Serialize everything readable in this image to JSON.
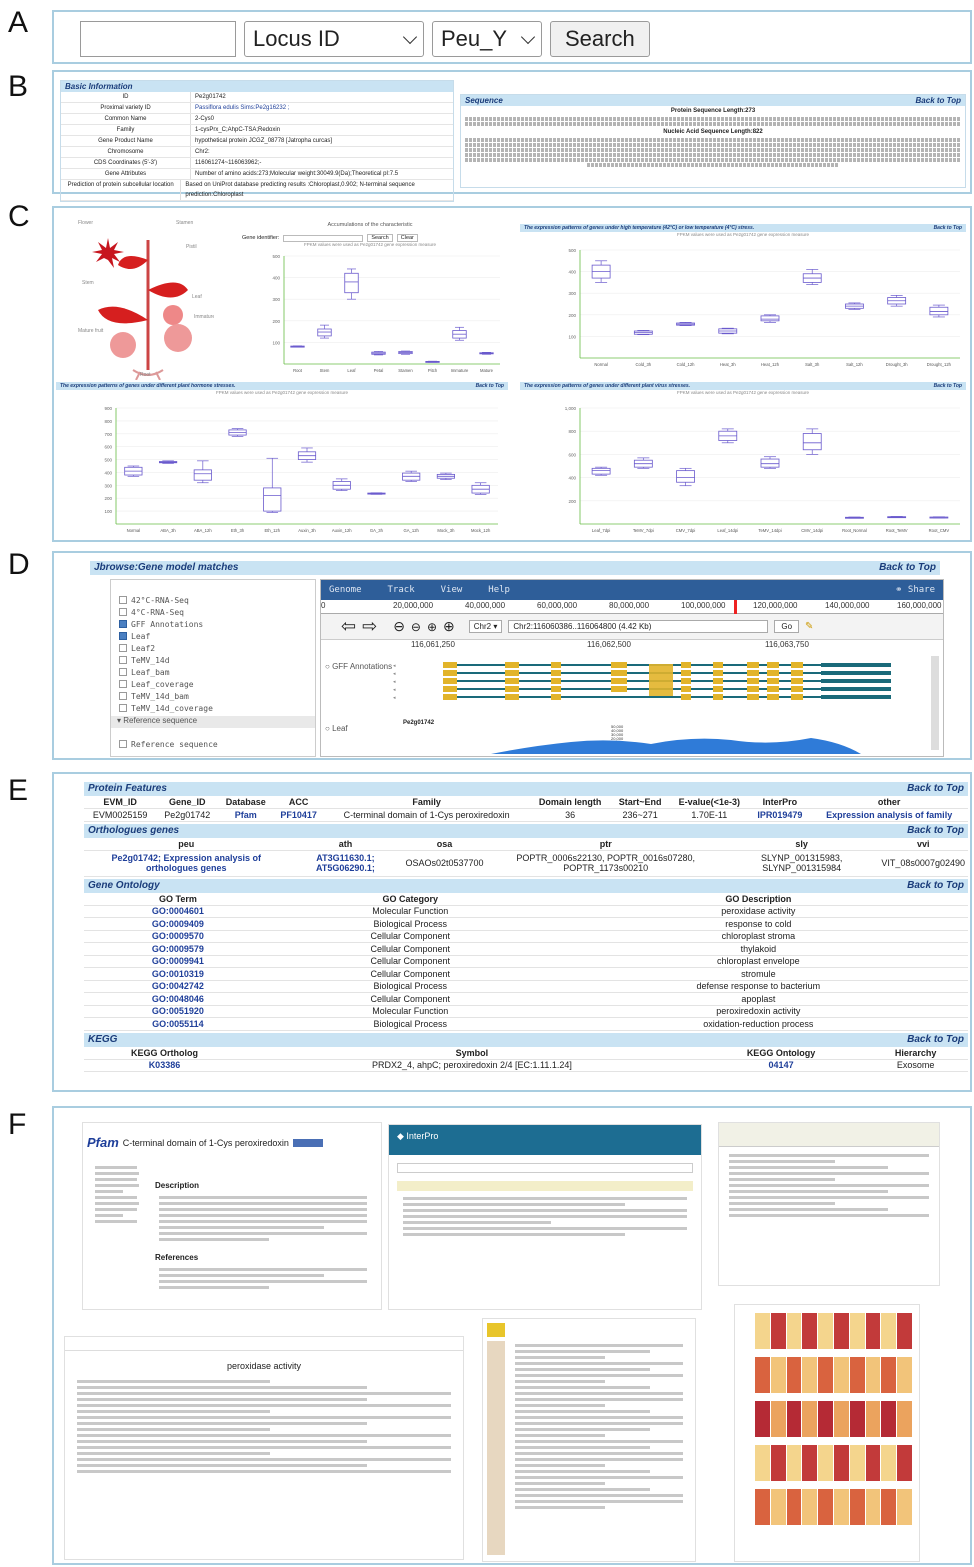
{
  "panel_labels": [
    "A",
    "B",
    "C",
    "D",
    "E",
    "F"
  ],
  "search": {
    "input_value": "",
    "field_select": "Locus ID",
    "species_select": "Peu_Y",
    "button": "Search"
  },
  "basic_info": {
    "header": "Basic Information",
    "rows": [
      {
        "k": "ID",
        "v": "Pe2g01742"
      },
      {
        "k": "Proximal variety ID",
        "v": "Passiflora edulis Sims:Pe2g16232 ;"
      },
      {
        "k": "Common Name",
        "v": "2-Cys0"
      },
      {
        "k": "Family",
        "v": "1-cysPrx_C;AhpC-TSA;Redoxin"
      },
      {
        "k": "Gene Product Name",
        "v": "hypothetical protein JCGZ_08778 [Jatropha curcas]"
      },
      {
        "k": "Chromosome",
        "v": "Chr2:"
      },
      {
        "k": "CDS Coordinates (5'-3')",
        "v": "116061274~116063962;-"
      },
      {
        "k": "Gene Attributes",
        "v": "Number of amino acids:273;Molecular weight:30049.9(Da);Theoretical pI:7.5"
      },
      {
        "k": "Prediction of protein subcellular location",
        "v": "Based on UniProt database predicting results :Chloroplast,0.902; N-terminal sequence prediction:Chloroplast"
      }
    ]
  },
  "sequence": {
    "header": "Sequence",
    "back": "Back to Top",
    "protein_label": "Protein Sequence   Length:273",
    "nucleic_label": "Nucleic Acid Sequence   Length:822"
  },
  "c_panel": {
    "tissue_title": "Accumulations of the characteristic",
    "gene_identifier_label": "Gene identifier:",
    "search_btn": "Search",
    "clear_btn": "Clear",
    "measure_caption": "FPKM values were used as Pe2g01742 gene expression measure",
    "tissue_labels": [
      "Flower",
      "Stamen",
      "Pistil",
      "Stem",
      "Leaf",
      "Root",
      "Immature fruit",
      "Mature fruit"
    ],
    "temp_header": "The expression patterns of genes under high temperature (42°C) or low temperature (4°C) stress.",
    "hormone_header": "The expression patterns of genes under different plant hormone stresses.",
    "virus_header": "The expression patterns of genes under different plant virus stresses.",
    "back": "Back to Top"
  },
  "chart_data": [
    {
      "type": "box",
      "categories": [
        "Root",
        "Stem",
        "Leaf",
        "Petal",
        "Stamen",
        "Pitch",
        "Immature",
        "Mature"
      ],
      "yticks": [
        100,
        200,
        300,
        400,
        500
      ],
      "ylim": [
        0,
        500
      ],
      "boxes": [
        {
          "min": 80,
          "q1": 78,
          "med": 80,
          "q3": 83,
          "max": 84
        },
        {
          "min": 120,
          "q1": 130,
          "med": 148,
          "q3": 162,
          "max": 180
        },
        {
          "min": 300,
          "q1": 330,
          "med": 380,
          "q3": 420,
          "max": 440
        },
        {
          "min": 42,
          "q1": 45,
          "med": 50,
          "q3": 55,
          "max": 58
        },
        {
          "min": 45,
          "q1": 48,
          "med": 53,
          "q3": 58,
          "max": 60
        },
        {
          "min": 8,
          "q1": 9,
          "med": 10,
          "q3": 12,
          "max": 13
        },
        {
          "min": 110,
          "q1": 120,
          "med": 138,
          "q3": 155,
          "max": 170
        },
        {
          "min": 45,
          "q1": 47,
          "med": 50,
          "q3": 52,
          "max": 54
        }
      ]
    },
    {
      "type": "box",
      "categories": [
        "Normal",
        "Cold_3h",
        "Cold_12h",
        "Heat_3h",
        "Heat_12h",
        "Salt_3h",
        "Salt_12h",
        "Drought_3h",
        "Drought_12h"
      ],
      "yticks": [
        100,
        200,
        300,
        400,
        500
      ],
      "ylim": [
        0,
        500
      ],
      "boxes": [
        {
          "min": 350,
          "q1": 370,
          "med": 400,
          "q3": 430,
          "max": 450
        },
        {
          "min": 108,
          "q1": 110,
          "med": 118,
          "q3": 125,
          "max": 128
        },
        {
          "min": 150,
          "q1": 152,
          "med": 157,
          "q3": 162,
          "max": 165
        },
        {
          "min": 112,
          "q1": 115,
          "med": 125,
          "q3": 135,
          "max": 138
        },
        {
          "min": 165,
          "q1": 172,
          "med": 180,
          "q3": 195,
          "max": 200
        },
        {
          "min": 340,
          "q1": 350,
          "med": 370,
          "q3": 390,
          "max": 410
        },
        {
          "min": 225,
          "q1": 230,
          "med": 240,
          "q3": 250,
          "max": 255
        },
        {
          "min": 240,
          "q1": 250,
          "med": 265,
          "q3": 280,
          "max": 290
        },
        {
          "min": 190,
          "q1": 200,
          "med": 215,
          "q3": 235,
          "max": 245
        }
      ]
    },
    {
      "type": "box",
      "categories": [
        "Normal",
        "ABA_3h",
        "ABA_12h",
        "Eth_3h",
        "Eth_12h",
        "Auxin_3h",
        "Auxin_12h",
        "GA_3h",
        "GA_12h",
        "Mock_3h",
        "Mock_12h"
      ],
      "yticks": [
        100,
        200,
        300,
        400,
        500,
        600,
        700,
        800,
        900
      ],
      "ylim": [
        0,
        900
      ],
      "boxes": [
        {
          "min": 370,
          "q1": 380,
          "med": 410,
          "q3": 440,
          "max": 450
        },
        {
          "min": 470,
          "q1": 475,
          "med": 480,
          "q3": 485,
          "max": 490
        },
        {
          "min": 320,
          "q1": 340,
          "med": 390,
          "q3": 420,
          "max": 490
        },
        {
          "min": 680,
          "q1": 690,
          "med": 710,
          "q3": 730,
          "max": 740
        },
        {
          "min": 90,
          "q1": 100,
          "med": 220,
          "q3": 280,
          "max": 510
        },
        {
          "min": 480,
          "q1": 500,
          "med": 530,
          "q3": 560,
          "max": 590
        },
        {
          "min": 260,
          "q1": 270,
          "med": 300,
          "q3": 330,
          "max": 350
        },
        {
          "min": 230,
          "q1": 232,
          "med": 236,
          "q3": 240,
          "max": 242
        },
        {
          "min": 330,
          "q1": 340,
          "med": 370,
          "q3": 395,
          "max": 410
        },
        {
          "min": 345,
          "q1": 355,
          "med": 370,
          "q3": 385,
          "max": 395
        },
        {
          "min": 230,
          "q1": 240,
          "med": 270,
          "q3": 300,
          "max": 320
        }
      ]
    },
    {
      "type": "box",
      "categories": [
        "Leaf_7dpi",
        "TeMV_7dpi",
        "CMV_7dpi",
        "Leaf_14dpi",
        "TeMV_14dpi",
        "CMV_14dpi",
        "Root_Normal",
        "Root_TeMV",
        "Root_CMV"
      ],
      "yticks": [
        200,
        400,
        600,
        800,
        1000
      ],
      "ylim": [
        0,
        1000
      ],
      "boxes": [
        {
          "min": 420,
          "q1": 430,
          "med": 460,
          "q3": 480,
          "max": 490
        },
        {
          "min": 480,
          "q1": 490,
          "med": 520,
          "q3": 550,
          "max": 570
        },
        {
          "min": 330,
          "q1": 360,
          "med": 400,
          "q3": 460,
          "max": 480
        },
        {
          "min": 700,
          "q1": 720,
          "med": 760,
          "q3": 800,
          "max": 820
        },
        {
          "min": 480,
          "q1": 490,
          "med": 520,
          "q3": 560,
          "max": 580
        },
        {
          "min": 600,
          "q1": 640,
          "med": 700,
          "q3": 780,
          "max": 820
        },
        {
          "min": 50,
          "q1": 52,
          "med": 55,
          "q3": 58,
          "max": 60
        },
        {
          "min": 55,
          "q1": 57,
          "med": 60,
          "q3": 63,
          "max": 65
        },
        {
          "min": 52,
          "q1": 54,
          "med": 57,
          "q3": 60,
          "max": 62
        }
      ]
    }
  ],
  "jbrowse": {
    "header": "Jbrowse:Gene model matches",
    "back": "Back to Top",
    "menu": [
      "Genome",
      "Track",
      "View",
      "Help"
    ],
    "share": "Share",
    "ruler": [
      "0",
      "20,000,000",
      "40,000,000",
      "60,000,000",
      "80,000,000",
      "100,000,000",
      "120,000,000",
      "140,000,000",
      "160,000,000"
    ],
    "chrom": "Chr2",
    "locus": "Chr2:116060386..116064800 (4.42 Kb)",
    "go": "Go",
    "subruler": [
      "116,061,250",
      "116,062,500",
      "116,063,750"
    ],
    "tracks": [
      {
        "label": "42°C-RNA-Seq",
        "checked": false
      },
      {
        "label": "4°C-RNA-Seq",
        "checked": false
      },
      {
        "label": "GFF Annotations",
        "checked": true
      },
      {
        "label": "Leaf",
        "checked": true
      },
      {
        "label": "Leaf2",
        "checked": false
      },
      {
        "label": "TeMV_14d",
        "checked": false
      },
      {
        "label": "Leaf_bam",
        "checked": false
      },
      {
        "label": "Leaf_coverage",
        "checked": false
      },
      {
        "label": "TeMV_14d_bam",
        "checked": false
      },
      {
        "label": "TeMV_14d_coverage",
        "checked": false
      }
    ],
    "ref_section": "Reference sequence",
    "ref_track": "Reference sequence",
    "gff_label": "GFF Annotations",
    "leaf_label": "Leaf",
    "gene_label": "Pe2g01742",
    "coverage_ticks": [
      "50,000",
      "40,000",
      "30,000",
      "20,000"
    ]
  },
  "protein_features": {
    "header": "Protein Features",
    "back": "Back to Top",
    "columns": [
      "EVM_ID",
      "Gene_ID",
      "Database",
      "ACC",
      "Family",
      "Domain length",
      "Start~End",
      "E-value(<1e-3)",
      "InterPro",
      "other"
    ],
    "row": [
      "EVM0025159",
      "Pe2g01742",
      "Pfam",
      "PF10417",
      "C-terminal domain of 1-Cys peroxiredoxin",
      "36",
      "236~271",
      "1.70E-11",
      "IPR019479",
      "Expression analysis of family"
    ]
  },
  "orthologues": {
    "header": "Orthologues genes",
    "back": "Back to Top",
    "columns": [
      "peu",
      "ath",
      "osa",
      "ptr",
      "sly",
      "vvi"
    ],
    "row": [
      "Pe2g01742; Expression analysis of orthologues genes",
      "AT3G11630.1; AT5G06290.1;",
      "OSAOs02t0537700",
      "POPTR_0006s22130, POPTR_0016s07280, POPTR_1173s00210",
      "SLYNP_001315983, SLYNP_001315984",
      "VIT_08s0007g02490"
    ]
  },
  "gene_ontology": {
    "header": "Gene Ontology",
    "back": "Back to Top",
    "columns": [
      "GO Term",
      "GO Category",
      "GO Description"
    ],
    "rows": [
      [
        "GO:0004601",
        "Molecular Function",
        "peroxidase activity"
      ],
      [
        "GO:0009409",
        "Biological Process",
        "response to cold"
      ],
      [
        "GO:0009570",
        "Cellular Component",
        "chloroplast stroma"
      ],
      [
        "GO:0009579",
        "Cellular Component",
        "thylakoid"
      ],
      [
        "GO:0009941",
        "Cellular Component",
        "chloroplast envelope"
      ],
      [
        "GO:0010319",
        "Cellular Component",
        "stromule"
      ],
      [
        "GO:0042742",
        "Biological Process",
        "defense response to bacterium"
      ],
      [
        "GO:0048046",
        "Cellular Component",
        "apoplast"
      ],
      [
        "GO:0051920",
        "Molecular Function",
        "peroxiredoxin activity"
      ],
      [
        "GO:0055114",
        "Biological Process",
        "oxidation-reduction process"
      ]
    ]
  },
  "kegg": {
    "header": "KEGG",
    "back": "Back to Top",
    "columns": [
      "KEGG Ortholog",
      "Symbol",
      "KEGG Ontology",
      "Hierarchy"
    ],
    "row": [
      "K03386",
      "PRDX2_4, ahpC; peroxiredoxin 2/4 [EC:1.11.1.24]",
      "04147",
      "Exosome"
    ]
  },
  "f_panel": {
    "pfam_logo": "Pfam",
    "pfam_title": "C-terminal domain of 1-Cys peroxiredoxin",
    "pfam_desc": "Description",
    "pfam_refs": "References",
    "interpro_title": "InterPro",
    "go_title": "peroxidase activity"
  },
  "colors": {
    "panel_border": "#a9cde0",
    "section_bg": "#c9e3f3",
    "link_blue": "#1f3f9a",
    "box_stroke": "#6a5acd",
    "axis_green": "#66bb44"
  }
}
